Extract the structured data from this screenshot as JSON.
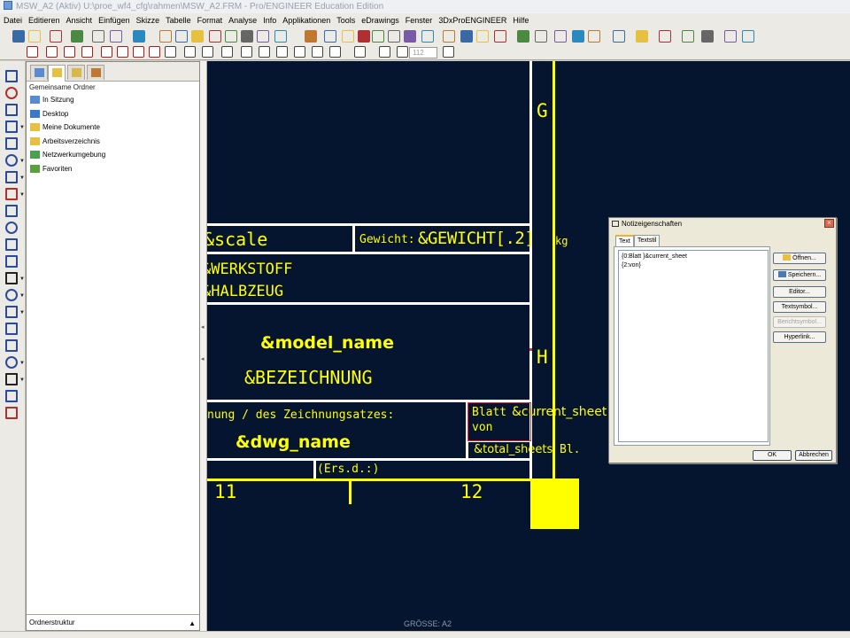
{
  "window": {
    "title": "MSW_A2 (Aktiv) U:\\proe_wf4_cfg\\rahmen\\MSW_A2.FRM - Pro/ENGINEER Education Edition"
  },
  "menu": [
    "Datei",
    "Editieren",
    "Ansicht",
    "Einfügen",
    "Skizze",
    "Tabelle",
    "Format",
    "Analyse",
    "Info",
    "Applikationen",
    "Tools",
    "eDrawings",
    "Fenster",
    "3DxProENGINEER",
    "Hilfe"
  ],
  "toolbar": {
    "zoom_value": "112",
    "icons": [
      "new-icon",
      "open-icon",
      "save-icon",
      "print-icon",
      "undo-icon",
      "redo-icon",
      "cut-icon",
      "copy-icon",
      "paste-icon",
      "find-icon",
      "zoom-in-icon",
      "zoom-out-icon",
      "refit-icon",
      "shading-icon",
      "appearance-icon",
      "help-icon",
      "close-window-icon"
    ]
  },
  "navigator": {
    "folder_header": "Gemeinsame Ordner",
    "folders": [
      {
        "label": "In Sitzung",
        "icon": "session-icon"
      },
      {
        "label": "Desktop",
        "icon": "desktop-icon"
      },
      {
        "label": "Meine Dokumente",
        "icon": "documents-folder-icon"
      },
      {
        "label": "Arbeitsverzeichnis",
        "icon": "working-directory-icon"
      },
      {
        "label": "Netzwerkumgebung",
        "icon": "network-icon"
      },
      {
        "label": "Favoriten",
        "icon": "favorites-icon"
      }
    ],
    "footer": "Ordnerstruktur"
  },
  "drawing": {
    "zone_g": "G",
    "zone_h": "H",
    "scale": "&scale",
    "weight_label": "Gewicht:",
    "weight_value": "&GEWICHT[.2]",
    "weight_unit": "kg",
    "material": "&WERKSTOFF",
    "semi_finished": "&HALBZEUG",
    "model_name": "&model_name",
    "description": "&BEZEICHNUNG",
    "drawing_set_text": "nung / des Zeichnungsatzes:",
    "dwg_name": "&dwg_name",
    "sheet_label": "Blatt",
    "current_sheet": "&current_sheet",
    "of_label": "von",
    "total_sheets": "&total_sheets",
    "sheets_abbrev": "Bl.",
    "replacement": "(Ers.d.:)",
    "column_11": "11",
    "column_12": "12",
    "paper_size": "GRÖSSE: A2"
  },
  "note_dialog": {
    "title": "Notizeigenschaften",
    "tabs": [
      "Text",
      "Textstil"
    ],
    "text_lines": [
      "{0:Blatt }&current_sheet",
      "{2:von}"
    ],
    "buttons": {
      "open": "Öffnen...",
      "save": "Speichern...",
      "editor": "Editor...",
      "text_symbol": "Textsymbol...",
      "report_symbol": "Berichtsymbol...",
      "hyperlink": "Hyperlink..."
    },
    "ok": "OK",
    "cancel": "Abbrechen"
  },
  "colors": {
    "canvas_bg": "#06152f",
    "format_lines": "#ffffff",
    "note_text": "#ffff00",
    "selection": "#e03040"
  }
}
